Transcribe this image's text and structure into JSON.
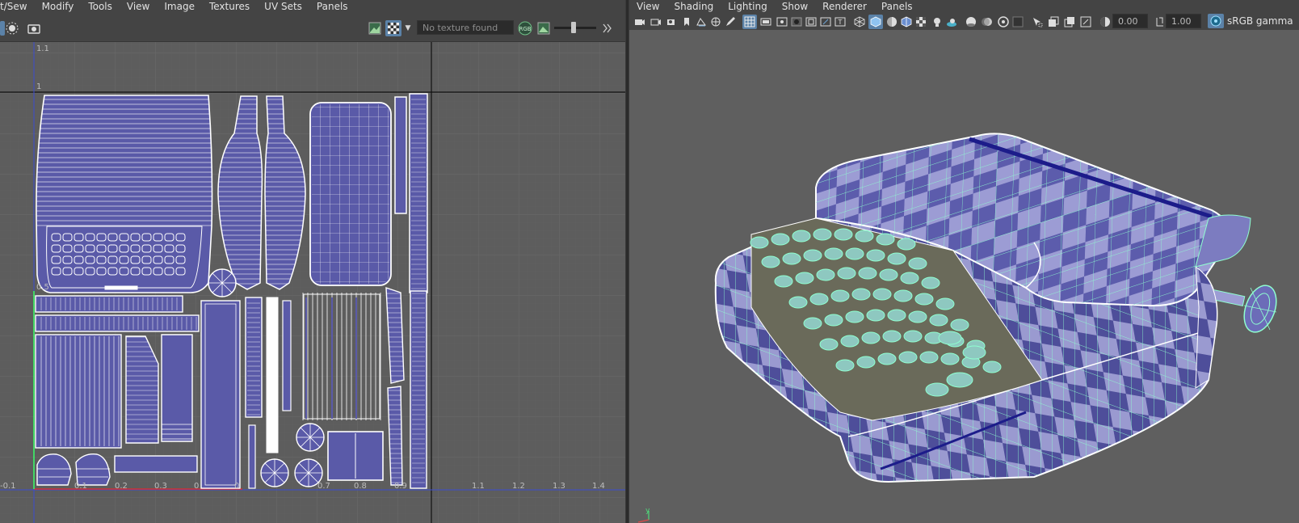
{
  "uv_editor": {
    "menu": [
      "t/Sew",
      "Modify",
      "Tools",
      "View",
      "Image",
      "Textures",
      "UV Sets",
      "Panels"
    ],
    "texture_field": "No texture found",
    "rgb_label": "RGB",
    "axis_labels": {
      "top_a": "1.1",
      "top_b": "1",
      "left_mid": "0.5",
      "x": [
        "-0.1",
        "0.1",
        "0.2",
        "0.3",
        "0",
        "0",
        "0.7",
        "0.8",
        "0.9",
        "1.1",
        "1.2",
        "1.3",
        "1.4"
      ]
    }
  },
  "viewport": {
    "menu": [
      "View",
      "Shading",
      "Lighting",
      "Show",
      "Renderer",
      "Panels"
    ],
    "exposure_value": "0.00",
    "gamma_value": "1.00",
    "color_space": "sRGB gamma",
    "axis_y_label": "y"
  },
  "colors": {
    "uv_shell_fill": "#5a5aa8",
    "wire_green": "#8fffd0",
    "checker_light": "#9c9cd4",
    "checker_dark": "#4e4e9a"
  }
}
